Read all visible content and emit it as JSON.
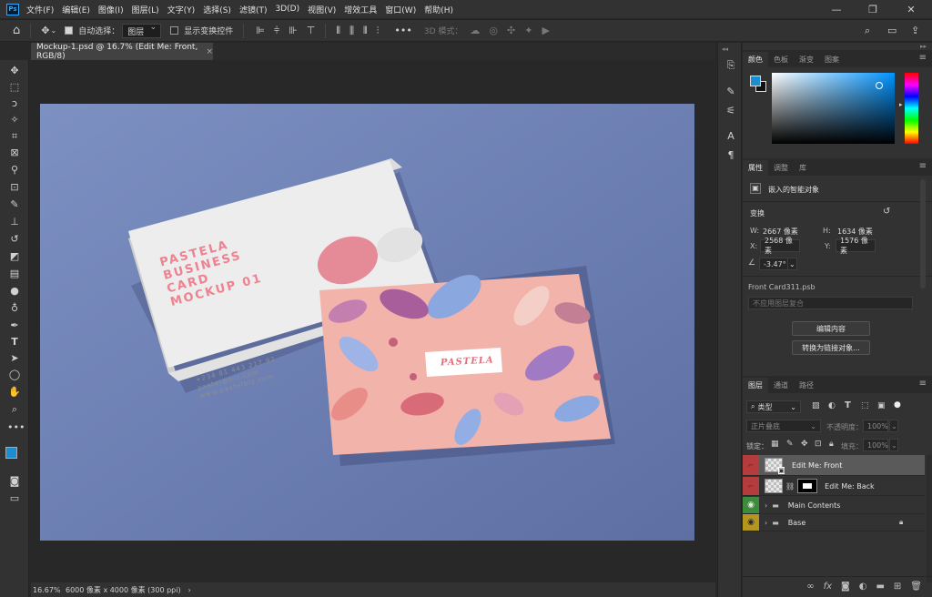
{
  "app": {
    "logo": "Ps",
    "menus": [
      "文件(F)",
      "编辑(E)",
      "图像(I)",
      "图层(L)",
      "文字(Y)",
      "选择(S)",
      "滤镜(T)",
      "3D(D)",
      "视图(V)",
      "增效工具",
      "窗口(W)",
      "帮助(H)"
    ]
  },
  "options": {
    "auto_select_label": "自动选择：",
    "auto_select_value": "图层",
    "show_transform_label": "显示变换控件",
    "mode_3d_label": "3D 模式："
  },
  "document_tab": {
    "title": "Mockup-1.psd @ 16.7% (Edit Me: Front, RGB/8)",
    "close": "×"
  },
  "status": {
    "zoom": "16.67%",
    "info": "6000 像素 x 4000 像素 (300 ppi)",
    "arrow": "›"
  },
  "mockup": {
    "white_card_title": [
      "PASTELA",
      "BUSINESS",
      "CARD",
      "MOCKUP 01"
    ],
    "white_card_contact": [
      "+234 81 443 217 92",
      "pastel@biz.com",
      "www.pastelbiz.com"
    ],
    "pink_card_logo": "PASTELA"
  },
  "color_panel": {
    "tabs": [
      "颜色",
      "色板",
      "渐变",
      "图案"
    ],
    "foreground": "#1c8dcf",
    "background": "#ffffff"
  },
  "properties_panel": {
    "tabs": [
      "属性",
      "调整",
      "库"
    ],
    "object_type": "嵌入的智能对象",
    "transform_label": "变换",
    "w_label": "W:",
    "w_value": "2667 像素",
    "h_label": "H:",
    "h_value": "1634 像素",
    "x_label": "X:",
    "x_value": "2568 像素",
    "y_label": "Y:",
    "y_value": "1576 像素",
    "angle_value": "-3.47°",
    "file_name": "Front Card311.psb",
    "comp_placeholder": "不应用图层复合",
    "edit_contents_button": "编辑内容",
    "convert_linked_button": "转换为链接对象..."
  },
  "layers_panel": {
    "tabs": [
      "图层",
      "通道",
      "路径"
    ],
    "filter_kind": "类型",
    "blend_mode": "正片叠底",
    "opacity_label": "不透明度：",
    "opacity_value": "100%",
    "lock_label": "锁定：",
    "fill_label": "填充：",
    "fill_value": "100%",
    "layers": [
      {
        "name": "Edit Me: Front",
        "eye_color": "#b43c3c",
        "selected": true
      },
      {
        "name": "Edit Me: Back",
        "eye_color": "#b43c3c",
        "selected": false
      },
      {
        "name": "Main Contents",
        "eye_color": "#3c8c3c",
        "selected": false
      },
      {
        "name": "Base",
        "eye_color": "#b4961e",
        "selected": false
      }
    ]
  }
}
